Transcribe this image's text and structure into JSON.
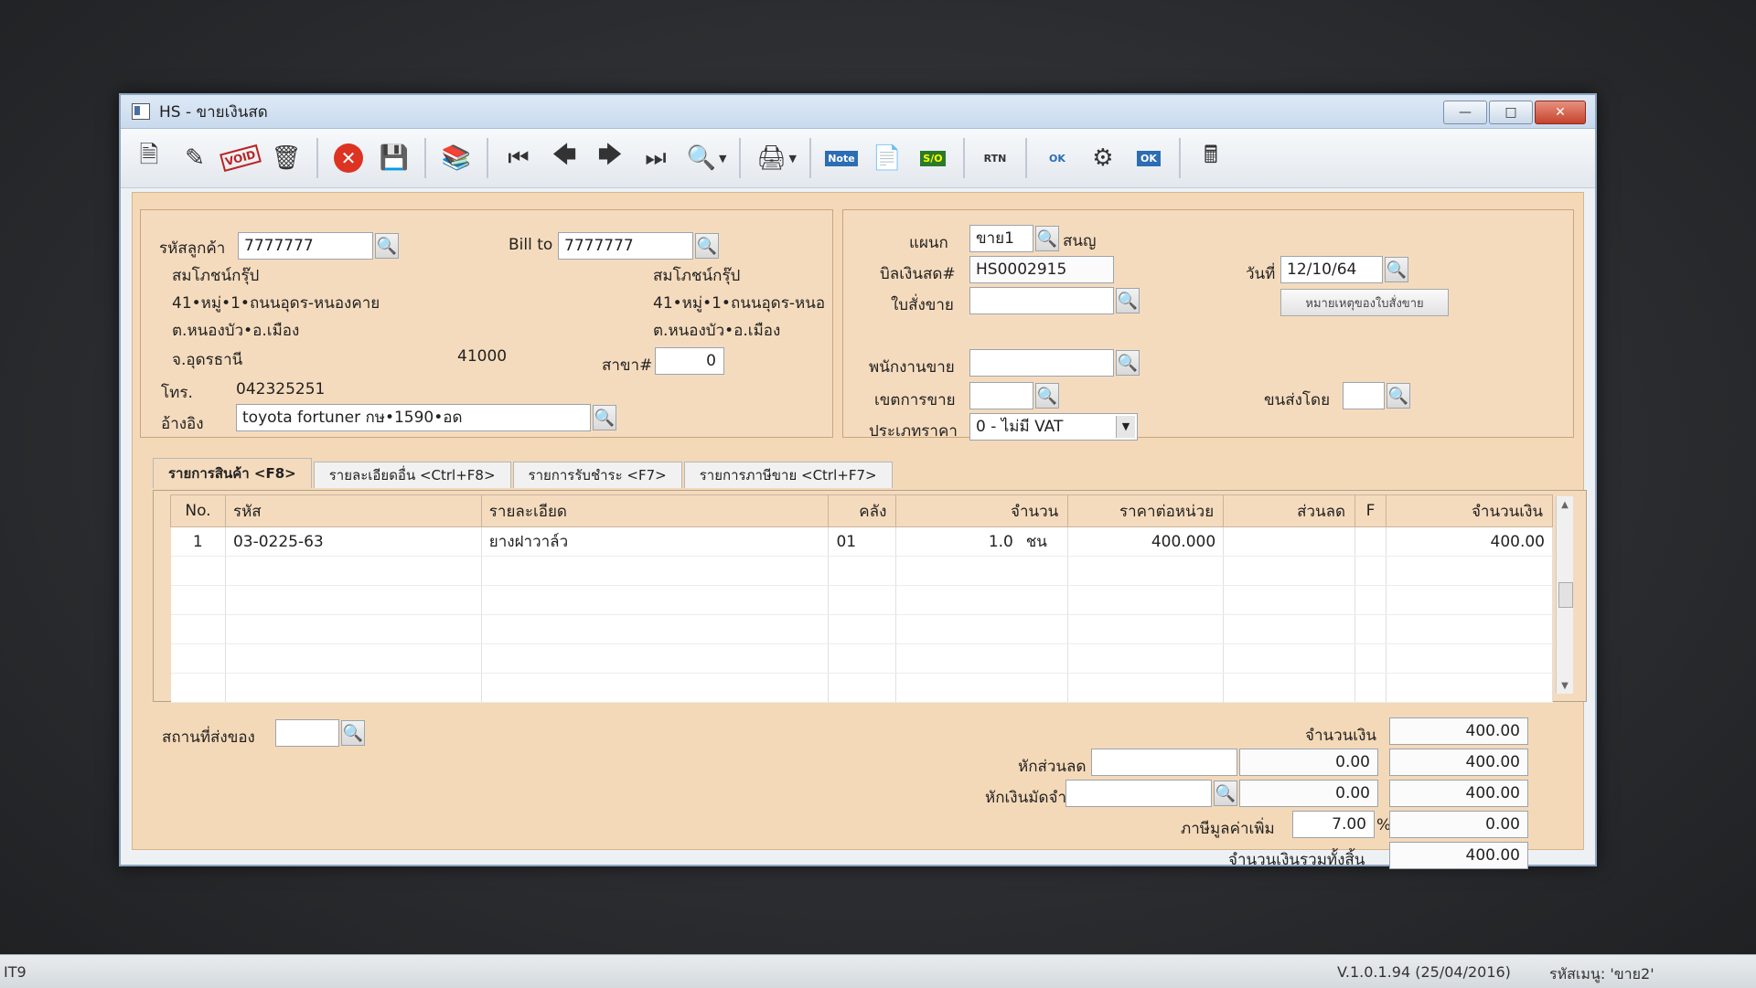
{
  "window": {
    "title": "HS - ขายเงินสด"
  },
  "customer": {
    "code_label": "รหัสลูกค้า",
    "code": "7777777",
    "bill_to_label": "Bill to",
    "bill_to": "7777777",
    "name": "สมโภชน์กรุ๊ป",
    "addr1": "41•หมู่•1•ถนนอุดร-หนองคาย",
    "addr2": "ต.หนองบัว•อ.เมือง",
    "province": "จ.อุดรธานี",
    "postcode": "41000",
    "bill_name": "สมโภชน์กรุ๊ป",
    "bill_addr1": "41•หมู่•1•ถนนอุดร-หนอ",
    "bill_addr2": "ต.หนองบัว•อ.เมือง",
    "branch_label": "สาขา#",
    "branch": "0",
    "phone_label": "โทร.",
    "phone": "042325251",
    "ref_label": "อ้างอิง",
    "ref": "toyota fortuner กษ•1590•อด"
  },
  "doc": {
    "dept_label": "แผนก",
    "dept": "ขาย1",
    "dept_name": "สนญ",
    "bill_label": "บิลเงินสด#",
    "bill_no": "HS0002915",
    "date_label": "วันที่",
    "date": "12/10/64",
    "so_label": "ใบสั่งขาย",
    "so": "",
    "so_note_button": "หมายเหตุของใบสั่งขาย",
    "salesman_label": "พนักงานขาย",
    "salesman": "",
    "zone_label": "เขตการขาย",
    "zone": "",
    "ship_by_label": "ขนส่งโดย",
    "ship_by": "",
    "price_type_label": "ประเภทราคา",
    "price_type": "0 - ไม่มี VAT"
  },
  "tabs": [
    {
      "label": "รายการสินค้า <F8>"
    },
    {
      "label": "รายละเอียดอื่น <Ctrl+F8>"
    },
    {
      "label": "รายการรับชำระ <F7>"
    },
    {
      "label": "รายการภาษีขาย <Ctrl+F7>"
    }
  ],
  "grid": {
    "headers": [
      "No.",
      "รหัส",
      "รายละเอียด",
      "คลัง",
      "จำนวน",
      "ราคาต่อหน่วย",
      "ส่วนลด",
      "F",
      "จำนวนเงิน"
    ],
    "rows": [
      {
        "no": "1",
        "code": "03-0225-63",
        "desc": "ยางฝาวาล์ว",
        "wh": "01",
        "qty": "1.0",
        "unit": "ชน",
        "price": "400.000",
        "disc": "",
        "f": "",
        "amount": "400.00"
      }
    ]
  },
  "delivery": {
    "label": "สถานที่ส่งของ",
    "value": ""
  },
  "totals": {
    "amount_label": "จำนวนเงิน",
    "amount": "400.00",
    "discount_label": "หักส่วนลด",
    "discount_text": "",
    "discount": "0.00",
    "after_discount": "400.00",
    "deposit_label": "หักเงินมัดจำ",
    "deposit_text": "",
    "deposit": "0.00",
    "after_deposit": "400.00",
    "vat_label": "ภาษีมูลค่าเพิ่ม",
    "vat_rate": "7.00",
    "vat_pct": "%",
    "vat": "0.00",
    "grand_label": "จำนวนเงินรวมทั้งสิ้น",
    "grand": "400.00"
  },
  "status": {
    "left": "IT9",
    "version": "V.1.0.1.94 (25/04/2016)",
    "menu_code": "รหัสเมนู: 'ขาย2'"
  }
}
